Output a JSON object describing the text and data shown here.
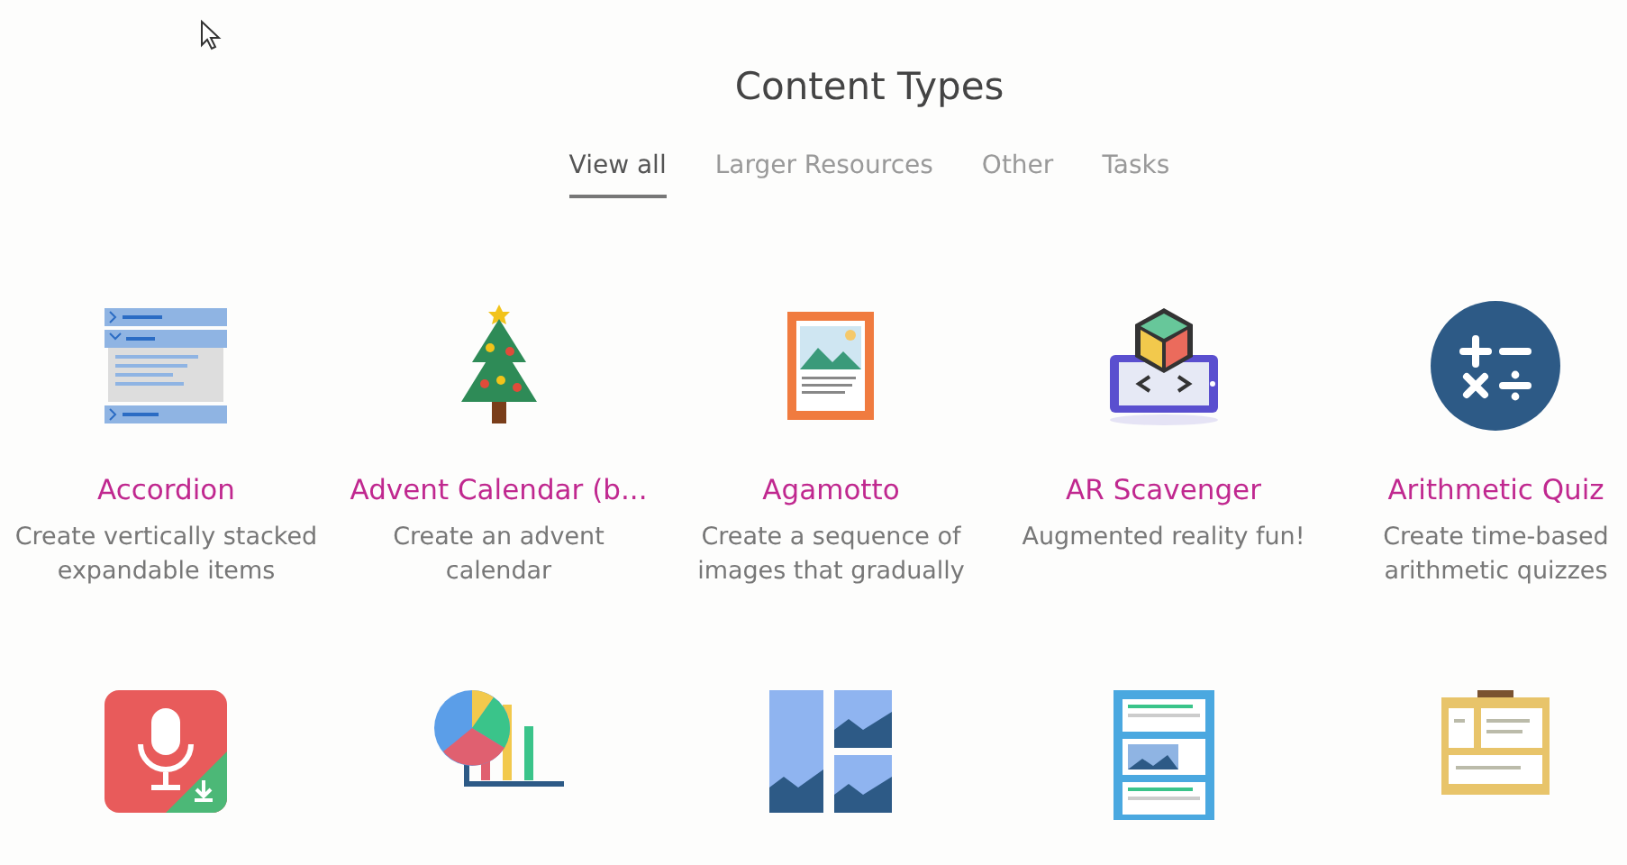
{
  "heading": "Content Types",
  "tabs": [
    {
      "label": "View all",
      "selected": true
    },
    {
      "label": "Larger Resources",
      "selected": false
    },
    {
      "label": "Other",
      "selected": false
    },
    {
      "label": "Tasks",
      "selected": false
    }
  ],
  "content_types": [
    {
      "kind": "full",
      "title": "Accordion",
      "description": "Create vertically stacked expandable items"
    },
    {
      "kind": "full",
      "title": "Advent Calendar (b...",
      "description": "Create an advent calendar"
    },
    {
      "kind": "full",
      "title": "Agamotto",
      "description": "Create a sequence of images that gradually"
    },
    {
      "kind": "full",
      "title": "AR Scavenger",
      "description": "Augmented reality fun!"
    },
    {
      "kind": "full",
      "title": "Arithmetic Quiz",
      "description": "Create time-based arithmetic quizzes"
    },
    {
      "kind": "icon-only"
    },
    {
      "kind": "icon-only"
    },
    {
      "kind": "icon-only"
    },
    {
      "kind": "icon-only"
    },
    {
      "kind": "icon-only"
    }
  ]
}
